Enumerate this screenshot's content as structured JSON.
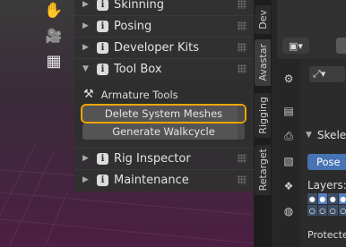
{
  "viewport": {
    "tools": [
      {
        "icon": "hand-pan-icon",
        "glyph": "✋"
      },
      {
        "icon": "camera-icon",
        "glyph": "🎥"
      },
      {
        "icon": "grid-icon",
        "glyph": "▦"
      }
    ]
  },
  "npanel": {
    "panels": [
      {
        "label": "Skinning",
        "expanded": false
      },
      {
        "label": "Posing",
        "expanded": false
      },
      {
        "label": "Developer Kits",
        "expanded": false
      },
      {
        "label": "Tool Box",
        "expanded": true
      },
      {
        "label": "Rig Inspector",
        "expanded": false
      },
      {
        "label": "Maintenance",
        "expanded": false
      }
    ],
    "info_glyph": "i",
    "collapsed_glyph": "▶",
    "expanded_glyph": "▼",
    "toolbox": {
      "section_label": "Armature Tools",
      "buttons": [
        {
          "label": "Delete System Meshes",
          "highlighted": true
        },
        {
          "label": "Generate Walkcycle",
          "highlighted": false
        }
      ]
    }
  },
  "tabs": [
    "Dev",
    "Avastar",
    "Rigging",
    "Retarget"
  ],
  "active_tab": "Avastar",
  "properties": {
    "header_label": "Skele",
    "pose_button": "Pose",
    "layers_label": "Layers:",
    "protected_label": "Protected"
  },
  "colors": {
    "highlight": "#f0a400",
    "pose_button": "#4772b3",
    "panel_bg": "#303030"
  }
}
